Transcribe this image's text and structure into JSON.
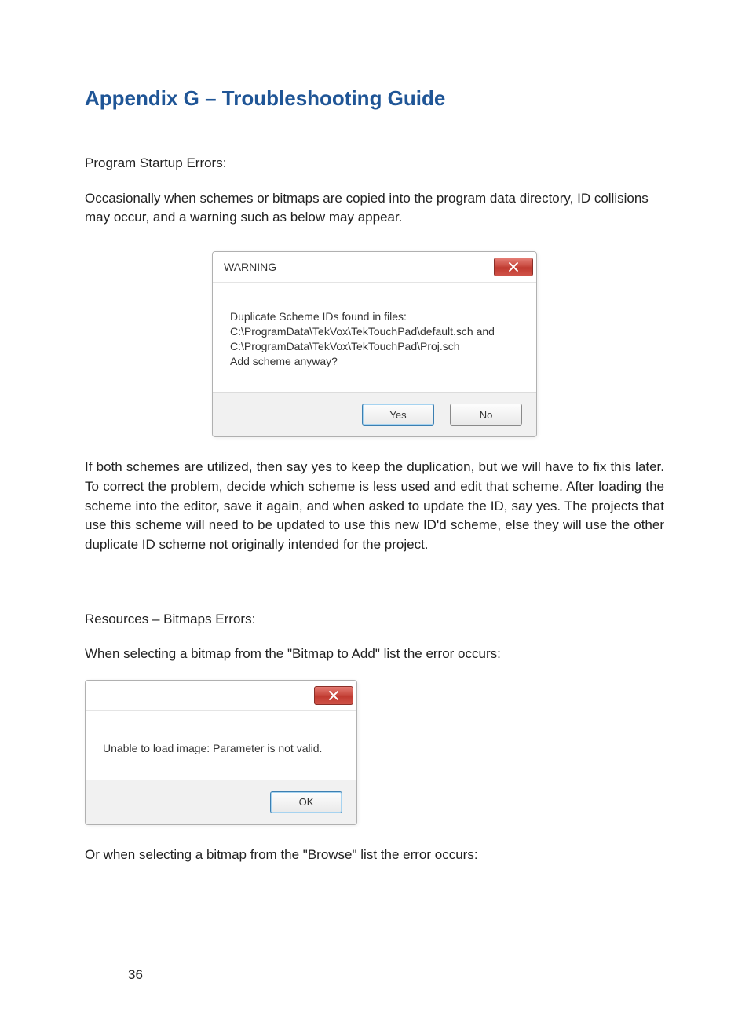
{
  "heading": "Appendix G – Troubleshooting Guide",
  "intro1": "Program Startup Errors:",
  "intro2": "Occasionally when schemes or bitmaps are copied into the program data directory, ID collisions may occur, and a warning such as below may appear.",
  "warning_dialog": {
    "title": "WARNING",
    "message": "Duplicate Scheme IDs found in files:\nC:\\ProgramData\\TekVox\\TekTouchPad\\default.sch and\nC:\\ProgramData\\TekVox\\TekTouchPad\\Proj.sch\nAdd scheme anyway?",
    "yes": "Yes",
    "no": "No"
  },
  "body1": "If both schemes are utilized, then say yes to keep the duplication, but we will have to fix this later. To correct the problem, decide which scheme is less used and edit that scheme. After loading the scheme into the editor, save it again, and when asked to update the ID, say yes. The projects that use this scheme will need to be updated to use this new ID'd scheme, else they will use the other duplicate ID scheme not originally intended for the project.",
  "section2_title": "Resources – Bitmaps Errors:",
  "section2_intro": "When selecting a bitmap from the \"Bitmap to Add\" list the error occurs:",
  "error_dialog": {
    "message": "Unable to load image: Parameter is not valid.",
    "ok": "OK"
  },
  "section2_after": "Or when selecting a bitmap from the \"Browse\" list the error occurs:",
  "page_number": "36"
}
